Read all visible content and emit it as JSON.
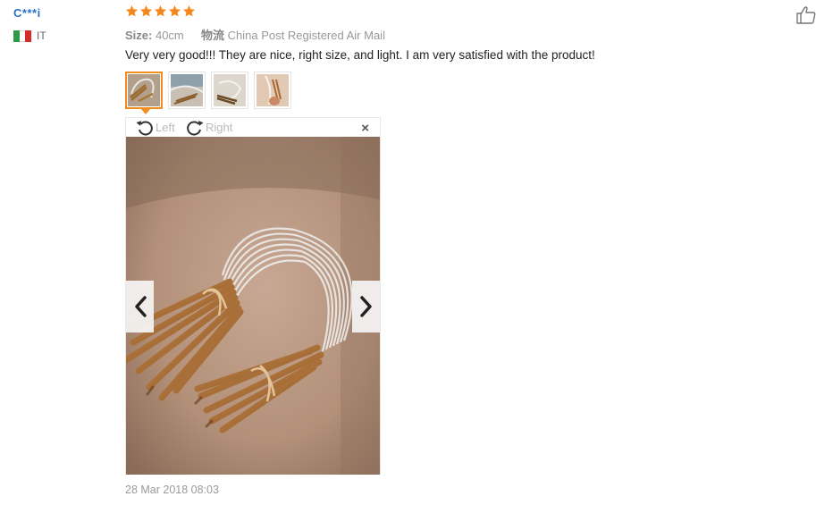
{
  "review": {
    "user": "C***i",
    "country": "IT",
    "rating": 5,
    "size_label": "Size:",
    "size_value": "40cm",
    "shipping_label": "物流",
    "shipping_value": "China Post Registered Air Mail",
    "text": "Very very good!!! They are nice, right size, and light. I am very satisfied with the product!",
    "date": "28 Mar 2018 08:03"
  },
  "viewer": {
    "rotate_left_label": "Left",
    "rotate_right_label": "Right",
    "close_symbol": "×"
  },
  "thumbnails": [
    {
      "name": "photo-1",
      "active": true
    },
    {
      "name": "photo-2",
      "active": false
    },
    {
      "name": "photo-3",
      "active": false
    },
    {
      "name": "photo-4",
      "active": false
    }
  ],
  "icons": {
    "star": "star-icon",
    "flag": "italy-flag-icon",
    "rotate_left": "rotate-left-icon",
    "rotate_right": "rotate-right-icon",
    "close": "close-icon",
    "prev": "chevron-left-icon",
    "next": "chevron-right-icon",
    "like": "thumbs-up-icon"
  },
  "colors": {
    "user_link": "#2a6fc9",
    "star": "#f5891f",
    "active_thumb_border": "#f08d1e",
    "flag_green": "#2f9a46",
    "flag_white": "#ffffff",
    "flag_red": "#d52b2b"
  }
}
